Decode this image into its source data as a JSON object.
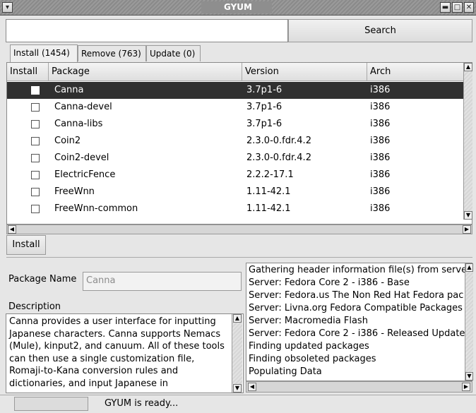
{
  "window": {
    "title": "GYUM"
  },
  "search": {
    "value": "",
    "button_label": "Search"
  },
  "tabs": [
    {
      "label": "Install (1454)",
      "active": true
    },
    {
      "label": "Remove (763)",
      "active": false
    },
    {
      "label": "Update (0)",
      "active": false
    }
  ],
  "table": {
    "columns": [
      "Install",
      "Package",
      "Version",
      "Arch"
    ],
    "rows": [
      {
        "package": "Canna",
        "version": "3.7p1-6",
        "arch": "i386",
        "selected": true
      },
      {
        "package": "Canna-devel",
        "version": "3.7p1-6",
        "arch": "i386"
      },
      {
        "package": "Canna-libs",
        "version": "3.7p1-6",
        "arch": "i386"
      },
      {
        "package": "Coin2",
        "version": "2.3.0-0.fdr.4.2",
        "arch": "i386"
      },
      {
        "package": "Coin2-devel",
        "version": "2.3.0-0.fdr.4.2",
        "arch": "i386"
      },
      {
        "package": "ElectricFence",
        "version": "2.2.2-17.1",
        "arch": "i386"
      },
      {
        "package": "FreeWnn",
        "version": "1.11-42.1",
        "arch": "i386"
      },
      {
        "package": "FreeWnn-common",
        "version": "1.11-42.1",
        "arch": "i386"
      }
    ]
  },
  "actions": {
    "install_label": "Install"
  },
  "details": {
    "package_name_label": "Package Name",
    "package_name_value": "Canna",
    "description_label": "Description",
    "description_text": "Canna provides a user interface for inputting Japanese characters. Canna supports Nemacs (Mule), kinput2, and canuum. All of these tools can then use a single customization file, Romaji-to-Kana conversion rules and dictionaries, and input Japanese in"
  },
  "log": {
    "lines": [
      "Gathering header information file(s) from server(",
      "Server: Fedora Core 2 - i386 - Base",
      "Server: Fedora.us The Non Red Hat Fedora pac",
      "Server: Livna.org Fedora Compatible Packages",
      "Server: Macromedia Flash",
      "Server: Fedora Core 2 - i386 - Released Update",
      "Finding updated packages",
      "Finding obsoleted packages",
      "Populating Data"
    ]
  },
  "status": {
    "text": "GYUM is ready..."
  },
  "colors": {
    "selected_row": "#303030",
    "titlebar": "#8e8e8e"
  },
  "icons": {
    "menu": "chevron-down-icon",
    "minimize": "minimize-icon",
    "maximize": "maximize-icon",
    "close": "close-icon"
  }
}
